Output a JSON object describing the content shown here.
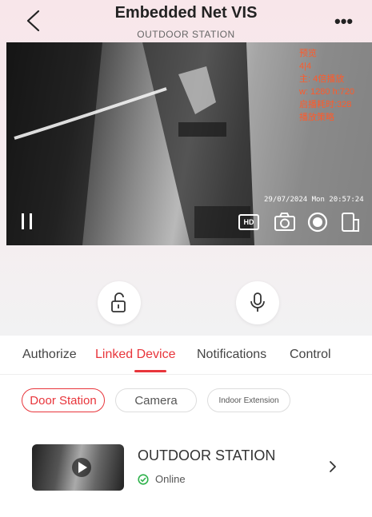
{
  "header": {
    "title": "Embedded Net VIS",
    "subtitle": "OUTDOOR STATION"
  },
  "video": {
    "overlay_lines": [
      "预览",
      "4|4",
      "主: 4倍播放",
      "w: 1280 h:720",
      "启播耗时:328",
      "播放策略"
    ],
    "timestamp": "29/07/2024 Mon 20:57:24",
    "hd_label": "HD"
  },
  "tabs": [
    {
      "label": "Authorize",
      "active": false
    },
    {
      "label": "Linked Device",
      "active": true
    },
    {
      "label": "Notifications",
      "active": false
    },
    {
      "label": "Control",
      "active": false
    }
  ],
  "chips": [
    {
      "label": "Door Station",
      "active": true
    },
    {
      "label": "Camera",
      "active": false
    },
    {
      "label": "Indoor Extension",
      "active": false
    }
  ],
  "device": {
    "name": "OUTDOOR STATION",
    "status": "Online"
  },
  "colors": {
    "accent": "#e8353b",
    "online": "#2fb24c",
    "overlay_text": "#ff5a2a"
  },
  "icons": [
    "back-icon",
    "more-icon",
    "pause-icon",
    "hd-icon",
    "snapshot-icon",
    "record-icon",
    "fullscreen-icon",
    "unlock-icon",
    "microphone-icon",
    "play-icon",
    "online-check-icon",
    "chevron-right-icon"
  ]
}
